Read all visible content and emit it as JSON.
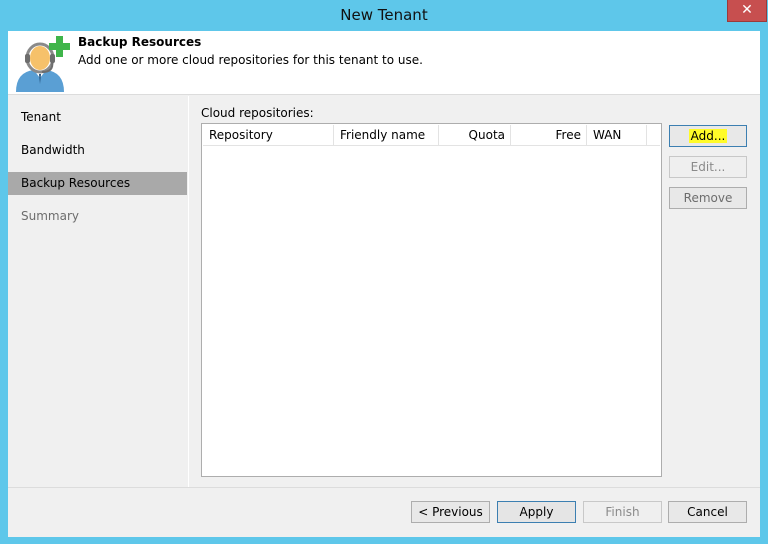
{
  "window": {
    "title": "New Tenant",
    "close_glyph": "✕"
  },
  "header": {
    "title": "Backup Resources",
    "description": "Add one or more cloud repositories for this tenant to use.",
    "icon": "tenant-add-icon"
  },
  "nav": {
    "items": [
      {
        "label": "Tenant",
        "state": "normal"
      },
      {
        "label": "Bandwidth",
        "state": "normal"
      },
      {
        "label": "Backup Resources",
        "state": "active"
      },
      {
        "label": "Summary",
        "state": "disabled"
      }
    ]
  },
  "repositories": {
    "label": "Cloud repositories:",
    "columns": [
      "Repository",
      "Friendly name",
      "Quota",
      "Free",
      "WAN"
    ],
    "rows": []
  },
  "side_buttons": {
    "add": "Add...",
    "edit": "Edit...",
    "remove": "Remove"
  },
  "footer": {
    "previous": "< Previous",
    "apply": "Apply",
    "finish": "Finish",
    "cancel": "Cancel"
  },
  "colors": {
    "titlebar": "#5ec7ea",
    "close": "#c74f4f",
    "highlight": "#fffb29",
    "nav_active": "#a9a9a9"
  }
}
